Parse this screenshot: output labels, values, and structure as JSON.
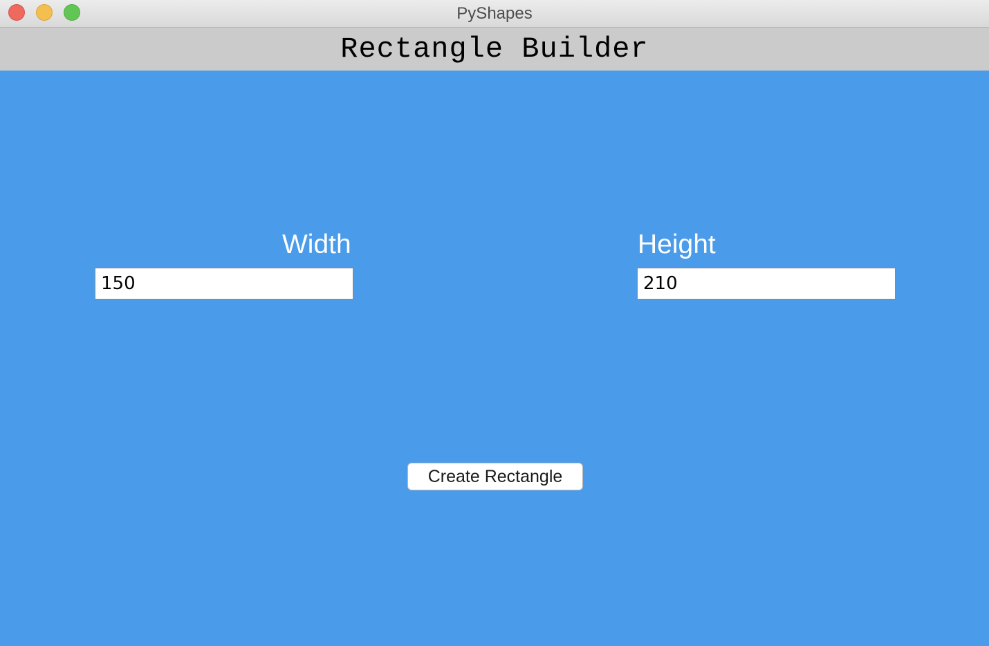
{
  "window": {
    "title": "PyShapes",
    "controls": {
      "close_icon": "close-icon",
      "minimize_icon": "minimize-icon",
      "zoom_icon": "zoom-icon"
    }
  },
  "header": {
    "title": "Rectangle Builder"
  },
  "form": {
    "width": {
      "label": "Width",
      "value": "150"
    },
    "height": {
      "label": "Height",
      "value": "210"
    },
    "submit_label": "Create Rectangle"
  },
  "colors": {
    "background": "#4a9be9",
    "header_bar": "#cbcbcb",
    "label_text": "#ffffff"
  }
}
